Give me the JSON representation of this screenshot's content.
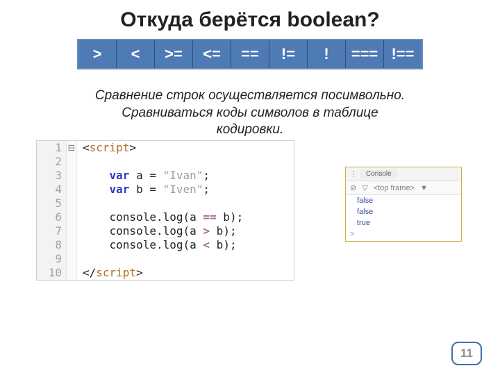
{
  "title": "Откуда берётся boolean?",
  "operators": [
    ">",
    "<",
    ">=",
    "<=",
    "==",
    "!=",
    "!",
    "===",
    "!=="
  ],
  "note": {
    "l1": "Сравнение строк осуществляется посимвольно.",
    "l2": "Сравниваться коды символов в таблице",
    "l3": "кодировки."
  },
  "code": {
    "tag_open": "script",
    "tag_close": "script",
    "kw_var": "var",
    "a_name": "a",
    "a_val": "\"Ivan\"",
    "b_name": "b",
    "b_val": "\"Iven\"",
    "call": "console.log",
    "op1": "==",
    "op2": ">",
    "op3": "<",
    "lines": [
      "1",
      "2",
      "3",
      "4",
      "5",
      "6",
      "7",
      "8",
      "9",
      "10"
    ]
  },
  "console": {
    "grip": "⋮",
    "tab": "Console",
    "noentry": "⊘",
    "filter": "▽",
    "frame_label": "<top frame>",
    "dropdown": "▼",
    "out": [
      "false",
      "false",
      "true"
    ],
    "prompt": ">"
  },
  "page_number": "11"
}
